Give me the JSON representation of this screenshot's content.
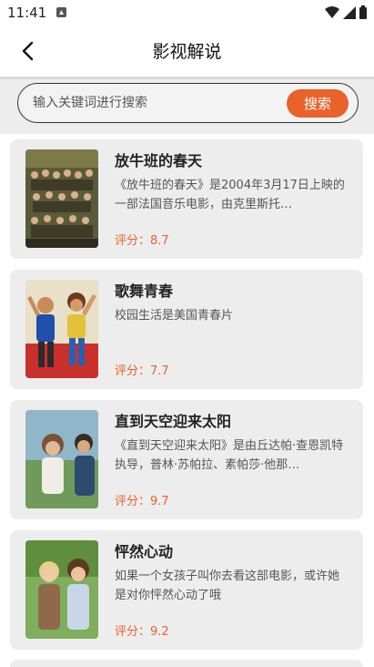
{
  "status": {
    "time": "11:41"
  },
  "header": {
    "title": "影视解说"
  },
  "search": {
    "placeholder": "输入关键词进行搜索",
    "value": "",
    "button_label": "搜索"
  },
  "movies": [
    {
      "name": "放牛班的春天",
      "desc": "《放牛班的春天》是2004年3月17日上映的一部法国音乐电影，由克里斯托…",
      "rating": "评分：8.7"
    },
    {
      "name": "歌舞青春",
      "desc": "校园生活是美国青春片",
      "rating": "评分：7.7"
    },
    {
      "name": "直到天空迎来太阳",
      "desc": "《直到天空迎来太阳》是由丘达帕·查恩凯特执导，普林·苏帕拉、素帕莎·他那…",
      "rating": "评分：9.7"
    },
    {
      "name": "怦然心动",
      "desc": "如果一个女孩子叫你去看这部电影，或许她是对你怦然心动了哦",
      "rating": "评分：9.2"
    }
  ],
  "colors": {
    "accent": "#e8622a",
    "card_bg": "#ededed"
  }
}
